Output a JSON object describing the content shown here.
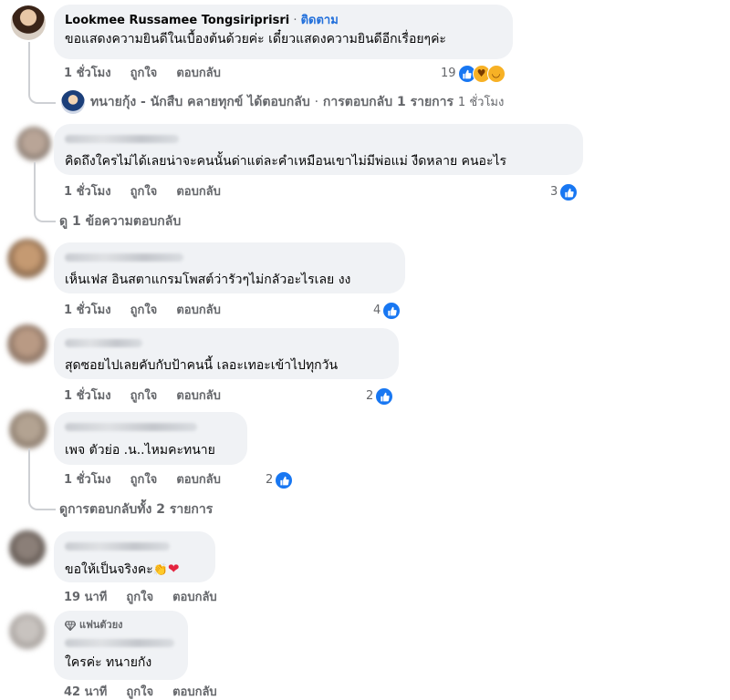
{
  "comments": [
    {
      "author": "Lookmee Russamee Tongsiriprisri",
      "follow_label": "ติดตาม",
      "text": "ขอแสดงความยินดีในเบื้องต้นด้วยค่ะ เดี๋ยวแสดงความยินดีอีกเรื่อยๆค่ะ",
      "time": "1 ชั่วโมง",
      "like_label": "ถูกใจ",
      "reply_label": "ตอบกลับ",
      "reaction_count": "19",
      "reply_summary": {
        "author": "ทนายกุ้ง - นักสืบ คลายทุกข์",
        "action": "ได้ตอบกลับ",
        "count": "การตอบกลับ 1 รายการ",
        "time": "1 ชั่วโมง"
      }
    },
    {
      "text": "คิดถึงใครไม่ได้เลยน่าจะคนนั้นด่าแต่ละคำเหมือนเขาไม่มีพ่อแม่ งืดหลาย คนอะไร",
      "time": "1 ชั่วโมง",
      "like_label": "ถูกใจ",
      "reply_label": "ตอบกลับ",
      "reaction_count": "3",
      "view_replies": "ดู 1 ข้อความตอบกลับ"
    },
    {
      "text": "เห็นเฟส อินสตาแกรมโพสต์ว่ารัวๆไม่กลัวอะไรเลย งง",
      "time": "1 ชั่วโมง",
      "like_label": "ถูกใจ",
      "reply_label": "ตอบกลับ",
      "reaction_count": "4"
    },
    {
      "text": "สุดซอยไปเลยคับกับป้าคนนี้ เลอะเทอะเข้าไปทุกวัน",
      "time": "1 ชั่วโมง",
      "like_label": "ถูกใจ",
      "reply_label": "ตอบกลับ",
      "reaction_count": "2"
    },
    {
      "text": "เพจ ตัวย่อ .น..ไหมคะทนาย",
      "time": "1 ชั่วโมง",
      "like_label": "ถูกใจ",
      "reply_label": "ตอบกลับ",
      "reaction_count": "2",
      "view_replies": "ดูการตอบกลับทั้ง 2 รายการ"
    },
    {
      "text": "ขอให้เป็นจริงคะ",
      "time": "19 นาที",
      "like_label": "ถูกใจ",
      "reply_label": "ตอบกลับ"
    },
    {
      "badge": "แฟนตัวยง",
      "text": "ใครค่ะ ทนายกัง",
      "time": "42 นาที",
      "like_label": "ถูกใจ",
      "reply_label": "ตอบกลับ"
    }
  ],
  "colors": {
    "bubble": "#f0f2f5",
    "action_text": "#65676b",
    "link_blue": "#216fdb",
    "like_blue": "#1877f2"
  }
}
